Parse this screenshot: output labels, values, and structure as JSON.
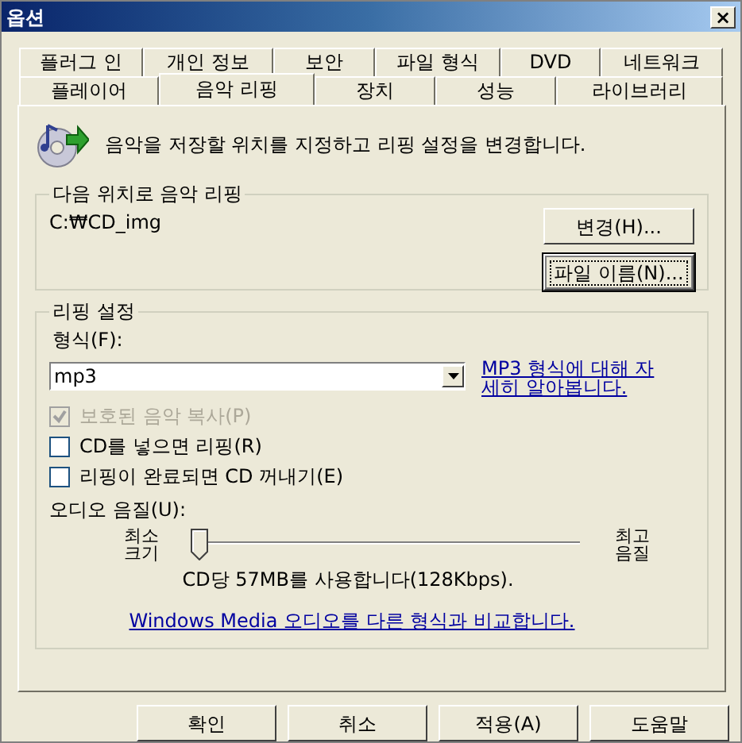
{
  "window": {
    "title": "옵션",
    "close": "×"
  },
  "tab_rows": [
    [
      {
        "label": "플러그 인",
        "selected": false
      },
      {
        "label": "개인 정보",
        "selected": false
      },
      {
        "label": "보안",
        "selected": false
      },
      {
        "label": "파일 형식",
        "selected": false
      },
      {
        "label": "DVD",
        "selected": false
      },
      {
        "label": "네트워크",
        "selected": false
      }
    ],
    [
      {
        "label": "플레이어",
        "selected": false
      },
      {
        "label": "음악 리핑",
        "selected": true
      },
      {
        "label": "장치",
        "selected": false
      },
      {
        "label": "성능",
        "selected": false
      },
      {
        "label": "라이브러리",
        "selected": false
      }
    ]
  ],
  "description": "음악을 저장할 위치를 지정하고 리핑 설정을 변경합니다.",
  "location": {
    "title": "다음 위치로 음악 리핑",
    "path": "C:₩CD_img",
    "buttons": [
      {
        "label": "변경(H)...",
        "focused": false
      },
      {
        "label": "파일 이름(N)...",
        "focused": true
      }
    ]
  },
  "settings": {
    "title": "리핑 설정",
    "format_label": "형식(F):",
    "format_value": "mp3",
    "format_link": "MP3 형식에 대해 자세히 알아봅니다.",
    "options": [
      {
        "label": "보호된 음악 복사(P)",
        "checked": true,
        "disabled": true
      },
      {
        "label": "CD를 넣으면 리핑(R)",
        "checked": false,
        "disabled": false
      },
      {
        "label": "리핑이 완료되면 CD 꺼내기(E)",
        "checked": false,
        "disabled": false
      }
    ],
    "quality_label": "오디오 음질(U):",
    "min_label": "최소 크기",
    "max_label": "최고 음질",
    "quality": {
      "level": 0
    },
    "usage": "CD당 57MB를 사용합니다(128Kbps).",
    "compare_link": "Windows Media 오디오를 다른 형식과 비교합니다."
  },
  "buttons": [
    "확인",
    "취소",
    "적용(A)",
    "도움말"
  ]
}
